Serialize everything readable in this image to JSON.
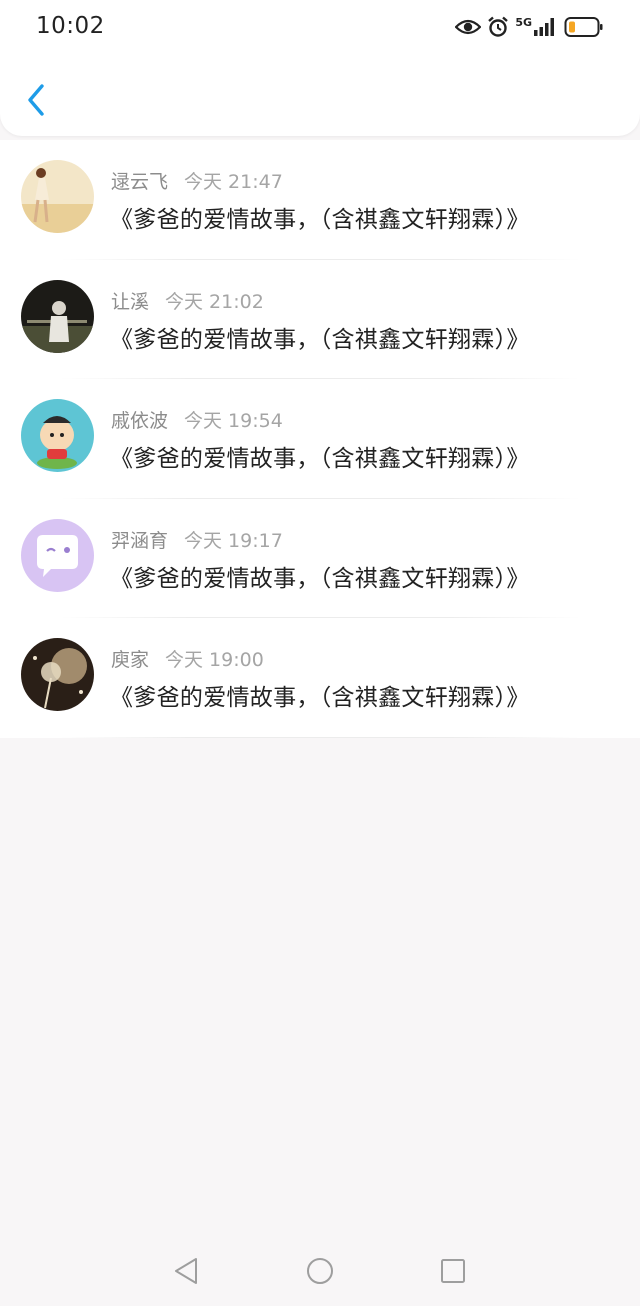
{
  "status_bar": {
    "time": "10:02",
    "network": "5G",
    "battery_color": "#f5a623",
    "icons": [
      "eye-icon",
      "alarm-icon",
      "signal-icon",
      "battery-icon"
    ]
  },
  "header": {
    "back_icon": "chevron-left-icon",
    "accent_color": "#1e9ce8"
  },
  "comments": [
    {
      "name": "逯云飞",
      "time": "今天 21:47",
      "text": "《爹爸的爱情故事，（含祺鑫文轩翔霖）》"
    },
    {
      "name": "让溪",
      "time": "今天 21:02",
      "text": "《爹爸的爱情故事，（含祺鑫文轩翔霖）》"
    },
    {
      "name": "戚依波",
      "time": "今天 19:54",
      "text": "《爹爸的爱情故事，（含祺鑫文轩翔霖）》"
    },
    {
      "name": "羿涵育",
      "time": "今天 19:17",
      "text": "《爹爸的爱情故事，（含祺鑫文轩翔霖）》"
    },
    {
      "name": "庾家",
      "time": "今天 19:00",
      "text": "《爹爸的爱情故事，（含祺鑫文轩翔霖）》"
    }
  ],
  "nav_bar": {
    "icons": [
      "back-triangle-icon",
      "home-circle-icon",
      "recents-square-icon"
    ]
  }
}
